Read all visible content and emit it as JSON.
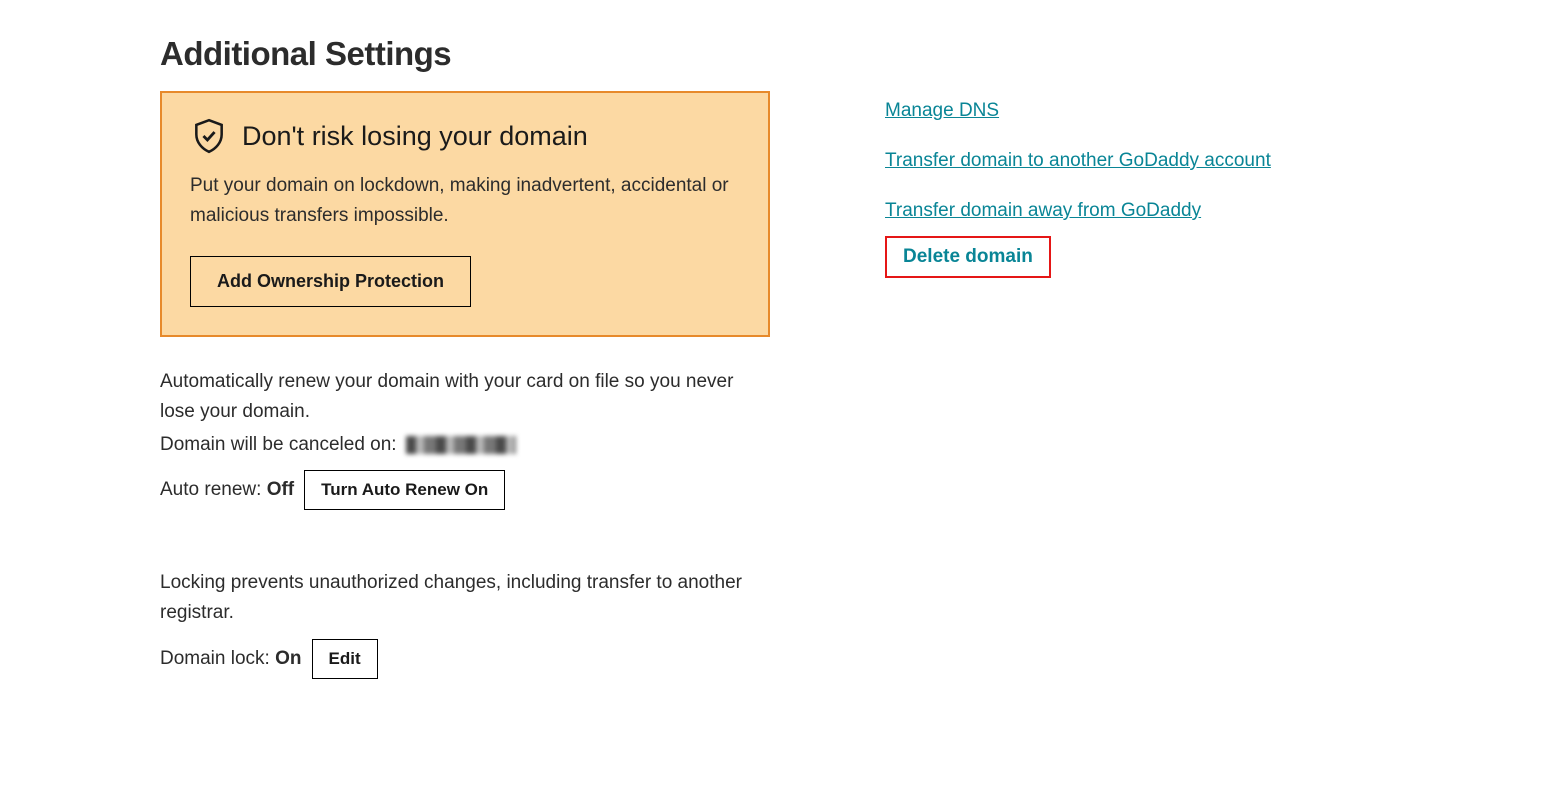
{
  "heading": "Additional Settings",
  "promo": {
    "title": "Don't risk losing your domain",
    "desc": "Put your domain on lockdown, making inadvertent, accidental or malicious transfers impossible.",
    "button": "Add Ownership Protection"
  },
  "autorenew": {
    "desc1": "Automatically renew your domain with your card on file so you never lose your domain.",
    "cancel_prefix": "Domain will be canceled on:",
    "label": "Auto renew:",
    "status": "Off",
    "button": "Turn Auto Renew On"
  },
  "lock": {
    "desc": "Locking prevents unauthorized changes, including transfer to another registrar.",
    "label": "Domain lock:",
    "status": "On",
    "button": "Edit"
  },
  "links": {
    "manage_dns": "Manage DNS",
    "transfer_to_godaddy": "Transfer domain to another GoDaddy account",
    "transfer_away": "Transfer domain away from GoDaddy",
    "delete": "Delete domain"
  },
  "colors": {
    "link": "#098596",
    "promo_border": "#e78a2b",
    "promo_bg": "#fcd9a3",
    "highlight_border": "#e51616"
  }
}
